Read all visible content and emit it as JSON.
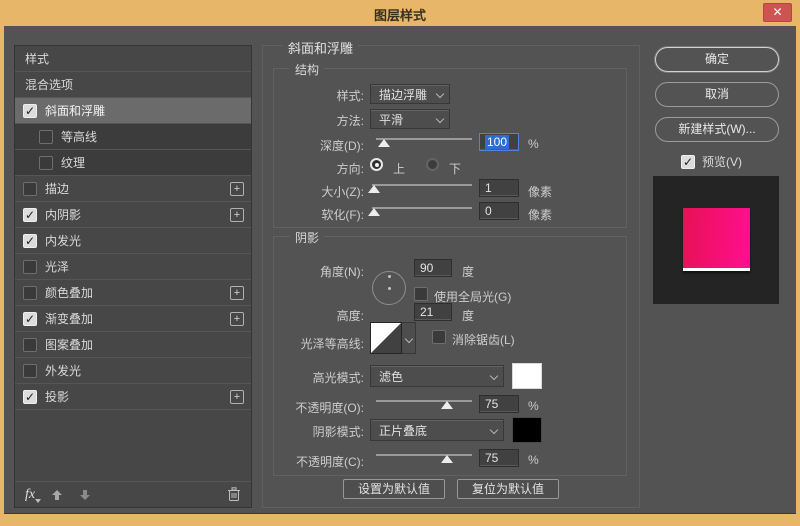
{
  "window": {
    "title": "图层样式",
    "close_icon": "✕"
  },
  "colors": {
    "titlebar": "#e7b668",
    "close_button": "#cd5450",
    "dialog_bg": "#535353",
    "selection_blue": "#2e6cd0",
    "preview_gradient_start": "#e81155",
    "preview_gradient_end": "#ff0f90",
    "highlight_swatch": "#ffffff",
    "shadow_swatch": "#000000"
  },
  "sidebar": {
    "items": [
      {
        "label": "样式",
        "checkbox": false,
        "checked": false,
        "selected": false,
        "sub": false,
        "plus": false
      },
      {
        "label": "混合选项",
        "checkbox": false,
        "checked": false,
        "selected": false,
        "sub": false,
        "plus": false
      },
      {
        "label": "斜面和浮雕",
        "checkbox": true,
        "checked": true,
        "selected": true,
        "sub": false,
        "plus": false
      },
      {
        "label": "等高线",
        "checkbox": true,
        "checked": false,
        "selected": false,
        "sub": true,
        "plus": false
      },
      {
        "label": "纹理",
        "checkbox": true,
        "checked": false,
        "selected": false,
        "sub": true,
        "plus": false
      },
      {
        "label": "描边",
        "checkbox": true,
        "checked": false,
        "selected": false,
        "sub": false,
        "plus": true
      },
      {
        "label": "内阴影",
        "checkbox": true,
        "checked": true,
        "selected": false,
        "sub": false,
        "plus": true
      },
      {
        "label": "内发光",
        "checkbox": true,
        "checked": true,
        "selected": false,
        "sub": false,
        "plus": false
      },
      {
        "label": "光泽",
        "checkbox": true,
        "checked": false,
        "selected": false,
        "sub": false,
        "plus": false
      },
      {
        "label": "颜色叠加",
        "checkbox": true,
        "checked": false,
        "selected": false,
        "sub": false,
        "plus": true
      },
      {
        "label": "渐变叠加",
        "checkbox": true,
        "checked": true,
        "selected": false,
        "sub": false,
        "plus": true
      },
      {
        "label": "图案叠加",
        "checkbox": true,
        "checked": false,
        "selected": false,
        "sub": false,
        "plus": false
      },
      {
        "label": "外发光",
        "checkbox": true,
        "checked": false,
        "selected": false,
        "sub": false,
        "plus": false
      },
      {
        "label": "投影",
        "checkbox": true,
        "checked": true,
        "selected": false,
        "sub": false,
        "plus": true
      }
    ],
    "footer": {
      "fx_label": "fx"
    }
  },
  "main": {
    "title": "斜面和浮雕",
    "structure": {
      "legend": "结构",
      "style_label": "样式:",
      "style_value": "描边浮雕",
      "technique_label": "方法:",
      "technique_value": "平滑",
      "depth_label": "深度(D):",
      "depth_value": "100",
      "depth_unit": "%",
      "direction_label": "方向:",
      "direction_up": "上",
      "direction_down": "下",
      "size_label": "大小(Z):",
      "size_value": "1",
      "size_unit": "像素",
      "soften_label": "软化(F):",
      "soften_value": "0",
      "soften_unit": "像素"
    },
    "shading": {
      "legend": "阴影",
      "angle_label": "角度(N):",
      "angle_value": "90",
      "angle_unit": "度",
      "global_light_label": "使用全局光(G)",
      "altitude_label": "高度:",
      "altitude_value": "21",
      "altitude_unit": "度",
      "gloss_contour_label": "光泽等高线:",
      "antialias_label": "消除锯齿(L)",
      "highlight_mode_label": "高光模式:",
      "highlight_mode_value": "滤色",
      "opacity_o_label": "不透明度(O):",
      "opacity_o_value": "75",
      "opacity_o_unit": "%",
      "shadow_mode_label": "阴影模式:",
      "shadow_mode_value": "正片叠底",
      "opacity_c_label": "不透明度(C):",
      "opacity_c_value": "75",
      "opacity_c_unit": "%"
    },
    "footer_buttons": {
      "make_default": "设置为默认值",
      "reset_default": "复位为默认值"
    }
  },
  "actions": {
    "ok": "确定",
    "cancel": "取消",
    "new_style": "新建样式(W)...",
    "preview": "预览(V)"
  },
  "sliders": {
    "depth": 8,
    "size": 2,
    "soften": 2,
    "opacity_o": 74,
    "opacity_c": 74
  }
}
